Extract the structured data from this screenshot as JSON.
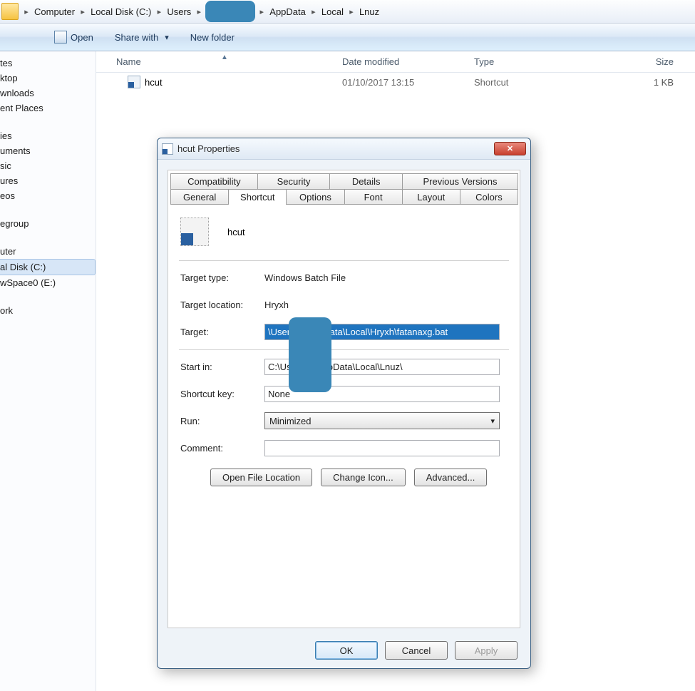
{
  "breadcrumb": {
    "items": [
      "Computer",
      "Local Disk (C:)",
      "Users",
      "",
      "AppData",
      "Local",
      "Lnuz"
    ]
  },
  "toolbar": {
    "open": "Open",
    "share": "Share with",
    "newfolder": "New folder"
  },
  "sidebar": {
    "items1": [
      "tes",
      "ktop",
      "wnloads",
      "ent Places"
    ],
    "items2": [
      "ies",
      "uments",
      "sic",
      "ures",
      "eos"
    ],
    "items3": [
      "egroup"
    ],
    "items4": [
      "uter",
      "al Disk (C:)",
      "wSpace0 (E:)"
    ],
    "items5": [
      "ork"
    ],
    "selected_index": 1
  },
  "columns": {
    "name": "Name",
    "date": "Date modified",
    "type": "Type",
    "size": "Size"
  },
  "file": {
    "name": "hcut",
    "date": "01/10/2017 13:15",
    "type": "Shortcut",
    "size": "1 KB"
  },
  "dialog": {
    "title": "hcut Properties",
    "tabs_row1": [
      "Compatibility",
      "Security",
      "Details",
      "Previous Versions"
    ],
    "tabs_row2": [
      "General",
      "Shortcut",
      "Options",
      "Font",
      "Layout",
      "Colors"
    ],
    "active_tab": "Shortcut",
    "icon_name": "hcut",
    "labels": {
      "target_type": "Target type:",
      "target_location": "Target location:",
      "target": "Target:",
      "start_in": "Start in:",
      "shortcut_key": "Shortcut key:",
      "run": "Run:",
      "comment": "Comment:"
    },
    "values": {
      "target_type": "Windows Batch File",
      "target_location": "Hryxh",
      "target": "\\Users\\        pData\\Local\\Hryxh\\fatanaxg.bat",
      "start_in": "C:\\Use        AppData\\Local\\Lnuz\\",
      "shortcut_key": "None",
      "run": "Minimized",
      "comment": ""
    },
    "buttons": {
      "open_loc": "Open File Location",
      "change_icon": "Change Icon...",
      "advanced": "Advanced...",
      "ok": "OK",
      "cancel": "Cancel",
      "apply": "Apply"
    }
  }
}
